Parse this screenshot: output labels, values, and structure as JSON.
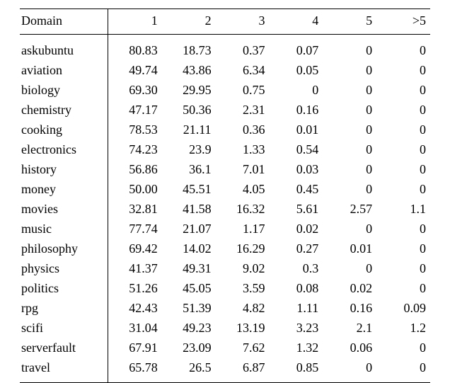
{
  "chart_data": {
    "type": "table",
    "title": "",
    "columns": [
      "Domain",
      "1",
      "2",
      "3",
      "4",
      "5",
      ">5"
    ],
    "rows": [
      {
        "domain": "askubuntu",
        "v": [
          "80.83",
          "18.73",
          "0.37",
          "0.07",
          "0",
          "0"
        ]
      },
      {
        "domain": "aviation",
        "v": [
          "49.74",
          "43.86",
          "6.34",
          "0.05",
          "0",
          "0"
        ]
      },
      {
        "domain": "biology",
        "v": [
          "69.30",
          "29.95",
          "0.75",
          "0",
          "0",
          "0"
        ]
      },
      {
        "domain": "chemistry",
        "v": [
          "47.17",
          "50.36",
          "2.31",
          "0.16",
          "0",
          "0"
        ]
      },
      {
        "domain": "cooking",
        "v": [
          "78.53",
          "21.11",
          "0.36",
          "0.01",
          "0",
          "0"
        ]
      },
      {
        "domain": "electronics",
        "v": [
          "74.23",
          "23.9",
          "1.33",
          "0.54",
          "0",
          "0"
        ]
      },
      {
        "domain": "history",
        "v": [
          "56.86",
          "36.1",
          "7.01",
          "0.03",
          "0",
          "0"
        ]
      },
      {
        "domain": "money",
        "v": [
          "50.00",
          "45.51",
          "4.05",
          "0.45",
          "0",
          "0"
        ]
      },
      {
        "domain": "movies",
        "v": [
          "32.81",
          "41.58",
          "16.32",
          "5.61",
          "2.57",
          "1.1"
        ]
      },
      {
        "domain": "music",
        "v": [
          "77.74",
          "21.07",
          "1.17",
          "0.02",
          "0",
          "0"
        ]
      },
      {
        "domain": "philosophy",
        "v": [
          "69.42",
          "14.02",
          "16.29",
          "0.27",
          "0.01",
          "0"
        ]
      },
      {
        "domain": "physics",
        "v": [
          "41.37",
          "49.31",
          "9.02",
          "0.3",
          "0",
          "0"
        ]
      },
      {
        "domain": "politics",
        "v": [
          "51.26",
          "45.05",
          "3.59",
          "0.08",
          "0.02",
          "0"
        ]
      },
      {
        "domain": "rpg",
        "v": [
          "42.43",
          "51.39",
          "4.82",
          "1.11",
          "0.16",
          "0.09"
        ]
      },
      {
        "domain": "scifi",
        "v": [
          "31.04",
          "49.23",
          "13.19",
          "3.23",
          "2.1",
          "1.2"
        ]
      },
      {
        "domain": "serverfault",
        "v": [
          "67.91",
          "23.09",
          "7.62",
          "1.32",
          "0.06",
          "0"
        ]
      },
      {
        "domain": "travel",
        "v": [
          "65.78",
          "26.5",
          "6.87",
          "0.85",
          "0",
          "0"
        ]
      }
    ]
  }
}
